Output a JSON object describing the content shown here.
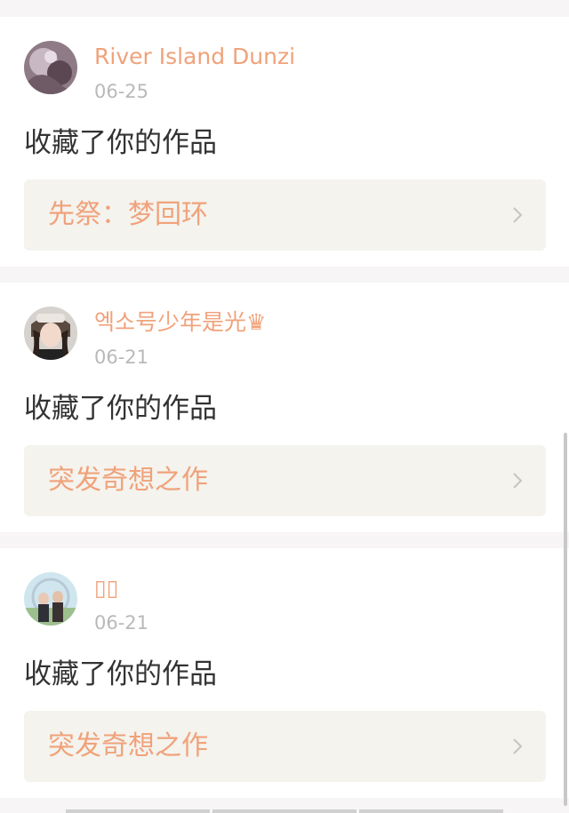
{
  "feed": {
    "items": [
      {
        "username": "River Island Dunzi",
        "date": "06-25",
        "action": "收藏了你的作品",
        "work_title": "先祭：梦回环",
        "avatar_icon": "avatar-abstract-purple"
      },
      {
        "username": "엑소号少年是光♛",
        "date": "06-21",
        "action": "收藏了你的作品",
        "work_title": "突发奇想之作",
        "avatar_icon": "avatar-girl-photo"
      },
      {
        "username": "▯▯",
        "date": "06-21",
        "action": "收藏了你的作品",
        "work_title": "突发奇想之作",
        "avatar_icon": "avatar-couple-photo"
      }
    ]
  },
  "colors": {
    "accent": "#f0a27a",
    "action_text": "#333333",
    "date_text": "#b9b9b9",
    "card_link_bg": "#f4f3ee",
    "page_bg": "#f7f5f5"
  }
}
